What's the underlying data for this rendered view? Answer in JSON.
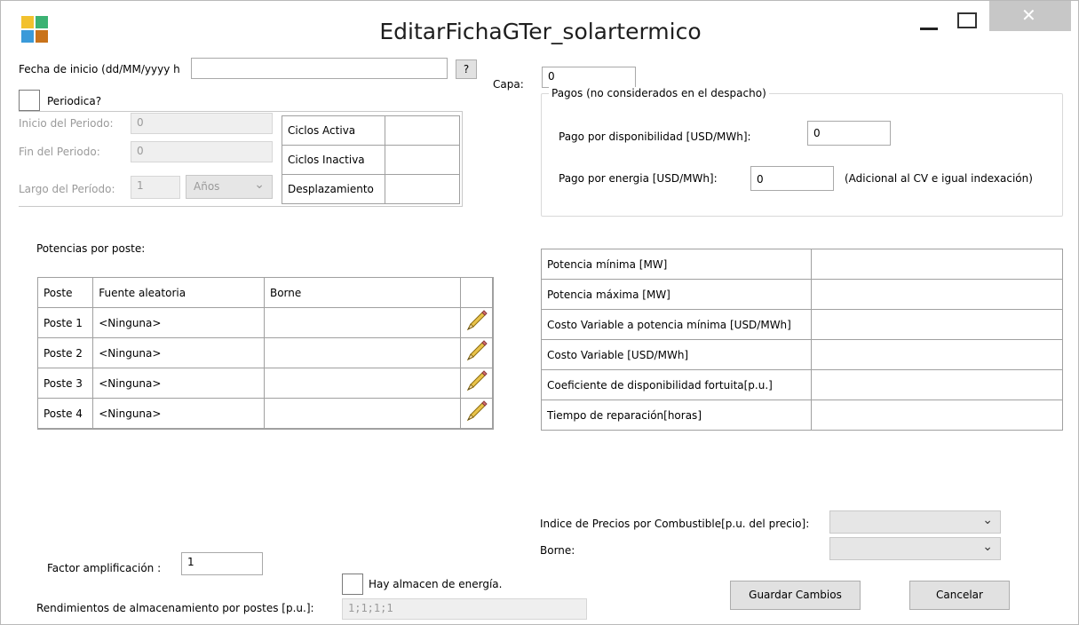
{
  "window": {
    "title": "EditarFichaGTer_solartermico",
    "minimize_label": "—",
    "maximize_label": "☐",
    "close_label": "✕"
  },
  "left": {
    "fecha_label": "Fecha de inicio (dd/MM/yyyy h",
    "fecha_value": "",
    "help_label": "?",
    "periodica_label": "Periodica?",
    "inicio_label": "Inicio del Periodo:",
    "inicio_value": "0",
    "fin_label": "Fin del Periodo:",
    "fin_value": "0",
    "largo_label": "Largo del Período:",
    "largo_value": "1",
    "largo_unit": "Años",
    "ciclos": [
      {
        "label": "Ciclos Activa",
        "value": ""
      },
      {
        "label": "Ciclos Inactiva",
        "value": ""
      },
      {
        "label": "Desplazamiento",
        "value": ""
      }
    ]
  },
  "capa": {
    "label": "Capa:",
    "value": "0"
  },
  "pagos": {
    "title": "Pagos (no considerados en el despacho)",
    "disponibilidad_label": "Pago por disponibilidad [USD/MWh]:",
    "disponibilidad_value": "0",
    "energia_label": "Pago por energia  [USD/MWh]:",
    "energia_value": "0",
    "energia_note": "(Adicional al CV e igual indexación)"
  },
  "potencias": {
    "title": "Potencias por poste:",
    "headers": [
      "Poste",
      "Fuente aleatoria",
      "Borne",
      ""
    ],
    "rows": [
      {
        "poste": "Poste 1",
        "fuente": "<Ninguna>",
        "borne": ""
      },
      {
        "poste": "Poste 2",
        "fuente": "<Ninguna>",
        "borne": ""
      },
      {
        "poste": "Poste 3",
        "fuente": "<Ninguna>",
        "borne": ""
      },
      {
        "poste": "Poste 4",
        "fuente": "<Ninguna>",
        "borne": ""
      }
    ],
    "edit_icon": "pencil-icon"
  },
  "params": {
    "rows": [
      {
        "label": "Potencia mínima [MW]",
        "value": ""
      },
      {
        "label": "Potencia máxima [MW]",
        "value": ""
      },
      {
        "label": "Costo Variable a potencia mínima [USD/MWh]",
        "value": ""
      },
      {
        "label": "Costo Variable [USD/MWh]",
        "value": ""
      },
      {
        "label": "Coeficiente de disponibilidad fortuita[p.u.]",
        "value": ""
      },
      {
        "label": "Tiempo de reparación[horas]",
        "value": ""
      }
    ]
  },
  "indices": {
    "indice_label": "Indice de Precios por Combustible[p.u. del precio]:",
    "indice_value": "",
    "borne_label": "Borne:",
    "borne_value": ""
  },
  "bottom": {
    "factor_label": "Factor amplificación :",
    "factor_value": "1",
    "almacen_label": "Hay almacen de energía.",
    "rend_label": "Rendimientos de almacenamiento por postes [p.u.]:",
    "rend_value": "1;1;1;1"
  },
  "actions": {
    "save_label": "Guardar Cambios",
    "cancel_label": "Cancelar"
  },
  "colors": {
    "logo": [
      "#f2c12e",
      "#3bb273",
      "#3a9ad9",
      "#c9731a"
    ],
    "close_bg": "#c7c7c7"
  }
}
